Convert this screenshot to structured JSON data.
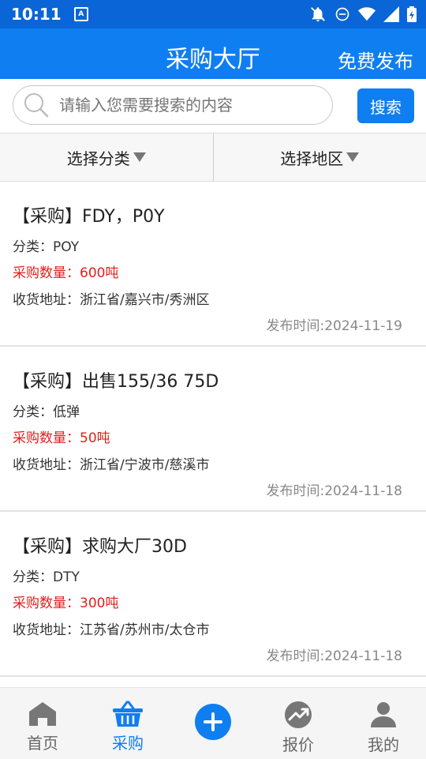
{
  "status_bar": {
    "time": "10:11"
  },
  "header": {
    "title": "采购大厅",
    "publish_label": "免费发布"
  },
  "search": {
    "placeholder": "请输入您需要搜索的内容",
    "button_label": "搜索"
  },
  "filters": {
    "category_label": "选择分类",
    "region_label": "选择地区"
  },
  "items": [
    {
      "title": "【采购】FDY，P0Y",
      "category": "分类：POY",
      "quantity": "采购数量：600吨",
      "address": "收货地址：浙江省/嘉兴市/秀洲区",
      "published": "发布时间:2024-11-19"
    },
    {
      "title": "【采购】出售155/36 75D",
      "category": "分类：低弹",
      "quantity": "采购数量：50吨",
      "address": "收货地址：浙江省/宁波市/慈溪市",
      "published": "发布时间:2024-11-18"
    },
    {
      "title": "【采购】求购大厂30D",
      "category": "分类：DTY",
      "quantity": "采购数量：300吨",
      "address": "收货地址：江苏省/苏州市/太仓市",
      "published": "发布时间:2024-11-18"
    }
  ],
  "tabs": [
    {
      "label": "首页",
      "icon": "home-icon"
    },
    {
      "label": "采购",
      "icon": "basket-icon"
    },
    {
      "label": "",
      "icon": "plus-icon"
    },
    {
      "label": "报价",
      "icon": "trend-icon"
    },
    {
      "label": "我的",
      "icon": "user-icon"
    }
  ],
  "colors": {
    "primary": "#0f7ef0",
    "status_bar": "#0a66d6",
    "quantity": "#e0201b"
  }
}
